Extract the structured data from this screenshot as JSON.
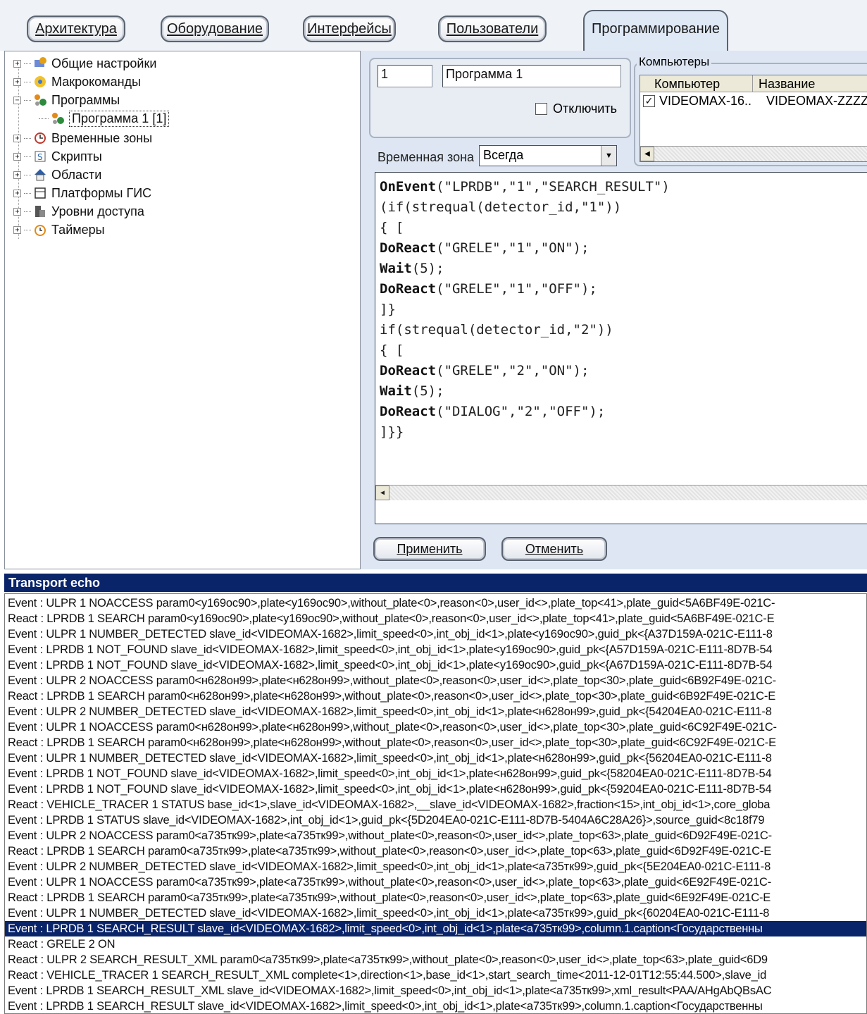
{
  "tabs": [
    {
      "label": "Архитектура"
    },
    {
      "label": "Оборудование"
    },
    {
      "label": "Интерфейсы"
    },
    {
      "label": "Пользователи"
    },
    {
      "label": "Программирование"
    }
  ],
  "tree": {
    "items": [
      {
        "label": "Общие настройки",
        "icon": "gear-icon"
      },
      {
        "label": "Макрокоманды",
        "icon": "macro-icon"
      },
      {
        "label": "Программы",
        "icon": "program-icon"
      },
      {
        "label": "Программа 1 [1]",
        "icon": "program-icon"
      },
      {
        "label": "Временные зоны",
        "icon": "clock-icon"
      },
      {
        "label": "Скрипты",
        "icon": "script-icon"
      },
      {
        "label": "Области",
        "icon": "house-icon"
      },
      {
        "label": "Платформы ГИС",
        "icon": "gis-icon"
      },
      {
        "label": "Уровни доступа",
        "icon": "access-icon"
      },
      {
        "label": "Таймеры",
        "icon": "timer-icon"
      }
    ]
  },
  "program": {
    "id_value": "1",
    "name_value": "Программа 1",
    "disable_label": "Отключить"
  },
  "computers": {
    "title": "Компьютеры",
    "columns": [
      "Компьютер",
      "Название"
    ],
    "row": {
      "computer": "VIDEOMAX-16..",
      "name": "VIDEOMAX-ZZZZ",
      "checked": true
    }
  },
  "time_zone": {
    "label": "Временная зона",
    "value": "Всегда"
  },
  "code_lines": [
    {
      "kw": "OnEvent",
      "rest": "(\"LPRDB\",\"1\",\"SEARCH_RESULT\")"
    },
    {
      "kw": "",
      "rest": "(if(strequal(detector_id,\"1\"))"
    },
    {
      "kw": "",
      "rest": "{ ["
    },
    {
      "kw": "DoReact",
      "rest": "(\"GRELE\",\"1\",\"ON\");"
    },
    {
      "kw": "Wait",
      "rest": "(5);"
    },
    {
      "kw": "DoReact",
      "rest": "(\"GRELE\",\"1\",\"OFF\");"
    },
    {
      "kw": "",
      "rest": "]}"
    },
    {
      "kw": "",
      "rest": "if(strequal(detector_id,\"2\"))"
    },
    {
      "kw": "",
      "rest": "{ ["
    },
    {
      "kw": "DoReact",
      "rest": "(\"GRELE\",\"2\",\"ON\");"
    },
    {
      "kw": "Wait",
      "rest": "(5);"
    },
    {
      "kw": "DoReact",
      "rest": "(\"DIALOG\",\"2\",\"OFF\");"
    },
    {
      "kw": "",
      "rest": "]}}"
    }
  ],
  "buttons": {
    "apply": "Применить",
    "cancel": "Отменить"
  },
  "echo": {
    "title": "Transport echo",
    "lines": [
      "Event : ULPR 1 NOACCESS param0<у169ос90>,plate<у169ос90>,without_plate<0>,reason<0>,user_id<>,plate_top<41>,plate_guid<5A6BF49E-021C-",
      "React : LPRDB 1 SEARCH param0<у169ос90>,plate<у169ос90>,without_plate<0>,reason<0>,user_id<>,plate_top<41>,plate_guid<5A6BF49E-021C-E",
      "Event : ULPR 1 NUMBER_DETECTED slave_id<VIDEOMAX-1682>,limit_speed<0>,int_obj_id<1>,plate<у169ос90>,guid_pk<{A37D159A-021C-E111-8",
      "Event : LPRDB 1 NOT_FOUND slave_id<VIDEOMAX-1682>,limit_speed<0>,int_obj_id<1>,plate<у169ос90>,guid_pk<{A57D159A-021C-E111-8D7B-54",
      "Event : LPRDB 1 NOT_FOUND slave_id<VIDEOMAX-1682>,limit_speed<0>,int_obj_id<1>,plate<у169ос90>,guid_pk<{A67D159A-021C-E111-8D7B-54",
      "Event : ULPR 2 NOACCESS param0<н628он99>,plate<н628он99>,without_plate<0>,reason<0>,user_id<>,plate_top<30>,plate_guid<6B92F49E-021C-",
      "React : LPRDB 1 SEARCH param0<н628он99>,plate<н628он99>,without_plate<0>,reason<0>,user_id<>,plate_top<30>,plate_guid<6B92F49E-021C-E",
      "Event : ULPR 2 NUMBER_DETECTED slave_id<VIDEOMAX-1682>,limit_speed<0>,int_obj_id<1>,plate<н628он99>,guid_pk<{54204EA0-021C-E111-8",
      "Event : ULPR 1 NOACCESS param0<н628он99>,plate<н628он99>,without_plate<0>,reason<0>,user_id<>,plate_top<30>,plate_guid<6C92F49E-021C-",
      "React : LPRDB 1 SEARCH param0<н628он99>,plate<н628он99>,without_plate<0>,reason<0>,user_id<>,plate_top<30>,plate_guid<6C92F49E-021C-E",
      "Event : ULPR 1 NUMBER_DETECTED slave_id<VIDEOMAX-1682>,limit_speed<0>,int_obj_id<1>,plate<н628он99>,guid_pk<{56204EA0-021C-E111-8",
      "Event : LPRDB 1 NOT_FOUND slave_id<VIDEOMAX-1682>,limit_speed<0>,int_obj_id<1>,plate<н628он99>,guid_pk<{58204EA0-021C-E111-8D7B-54",
      "Event : LPRDB 1 NOT_FOUND slave_id<VIDEOMAX-1682>,limit_speed<0>,int_obj_id<1>,plate<н628он99>,guid_pk<{59204EA0-021C-E111-8D7B-54",
      "React : VEHICLE_TRACER 1 STATUS base_id<1>,slave_id<VIDEOMAX-1682>,__slave_id<VIDEOMAX-1682>,fraction<15>,int_obj_id<1>,core_globa",
      "Event : LPRDB 1 STATUS slave_id<VIDEOMAX-1682>,int_obj_id<1>,guid_pk<{5D204EA0-021C-E111-8D7B-5404A6C28A26}>,source_guid<8c18f79",
      "Event : ULPR 2 NOACCESS param0<а735тк99>,plate<а735тк99>,without_plate<0>,reason<0>,user_id<>,plate_top<63>,plate_guid<6D92F49E-021C-",
      "React : LPRDB 1 SEARCH param0<а735тк99>,plate<а735тк99>,without_plate<0>,reason<0>,user_id<>,plate_top<63>,plate_guid<6D92F49E-021C-E",
      "Event : ULPR 2 NUMBER_DETECTED slave_id<VIDEOMAX-1682>,limit_speed<0>,int_obj_id<1>,plate<а735тк99>,guid_pk<{5E204EA0-021C-E111-8",
      "Event : ULPR 1 NOACCESS param0<а735тк99>,plate<а735тк99>,without_plate<0>,reason<0>,user_id<>,plate_top<63>,plate_guid<6E92F49E-021C-",
      "React : LPRDB 1 SEARCH param0<а735тк99>,plate<а735тк99>,without_plate<0>,reason<0>,user_id<>,plate_top<63>,plate_guid<6E92F49E-021C-E",
      "Event : ULPR 1 NUMBER_DETECTED slave_id<VIDEOMAX-1682>,limit_speed<0>,int_obj_id<1>,plate<а735тк99>,guid_pk<{60204EA0-021C-E111-8",
      "Event : LPRDB 1 SEARCH_RESULT slave_id<VIDEOMAX-1682>,limit_speed<0>,int_obj_id<1>,plate<а735тк99>,column.1.caption<Государственны",
      "React : GRELE 2 ON",
      "React : ULPR 2 SEARCH_RESULT_XML param0<а735тк99>,plate<а735тк99>,without_plate<0>,reason<0>,user_id<>,plate_top<63>,plate_guid<6D9",
      "React : VEHICLE_TRACER 1 SEARCH_RESULT_XML complete<1>,direction<1>,base_id<1>,start_search_time<2011-12-01T12:55:44.500>,slave_id",
      "Event : LPRDB 1 SEARCH_RESULT_XML slave_id<VIDEOMAX-1682>,limit_speed<0>,int_obj_id<1>,plate<а735тк99>,xml_result<PAA/AHgAbQBsAC",
      "Event : LPRDB 1 SEARCH_RESULT slave_id<VIDEOMAX-1682>,limit_speed<0>,int_obj_id<1>,plate<а735тк99>,column.1.caption<Государственны"
    ],
    "selected_index": 21
  }
}
